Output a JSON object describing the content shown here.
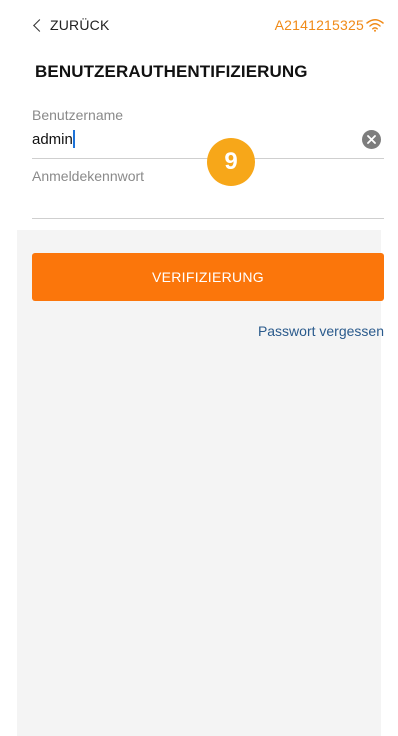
{
  "header": {
    "back_label": "ZURÜCK",
    "device_id": "A2141215325",
    "wifi_icon": "wifi-icon",
    "accent_color": "#f08a17"
  },
  "page": {
    "title": "BENUTZERAUTHENTIFIZIERUNG"
  },
  "form": {
    "username_label": "Benutzername",
    "username_value": "admin",
    "password_label": "Anmeldekennwort",
    "password_value": "",
    "clear_icon": "clear-icon"
  },
  "badge": {
    "number": "9",
    "color": "#f7a719"
  },
  "actions": {
    "verify_label": "VERIFIZIERUNG",
    "verify_color": "#fb760b",
    "forgot_password_label": "Passwort vergessen"
  }
}
